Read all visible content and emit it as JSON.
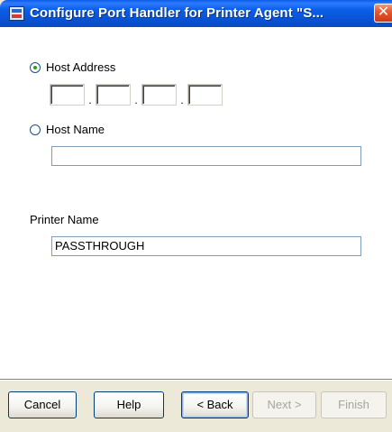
{
  "window": {
    "title": "Configure Port Handler for Printer Agent \"S...",
    "close_symbol": "✕"
  },
  "host_address": {
    "label": "Host Address",
    "selected": true,
    "octets": [
      "",
      "",
      "",
      ""
    ],
    "separator": "."
  },
  "host_name": {
    "label": "Host Name",
    "selected": false,
    "value": ""
  },
  "printer_name": {
    "label": "Printer Name",
    "value": "PASSTHROUGH"
  },
  "buttons": {
    "cancel": "Cancel",
    "help": "Help",
    "back": "< Back",
    "next": "Next >",
    "finish": "Finish"
  },
  "icons": {
    "app": "window-app-icon",
    "close": "close-icon",
    "radio_checked": "radio-checked-icon",
    "radio_unchecked": "radio-unchecked-icon"
  },
  "colors": {
    "titlebar_blue": "#0a5be8",
    "close_red": "#e45a31",
    "dialog_face": "#ece9d8"
  }
}
